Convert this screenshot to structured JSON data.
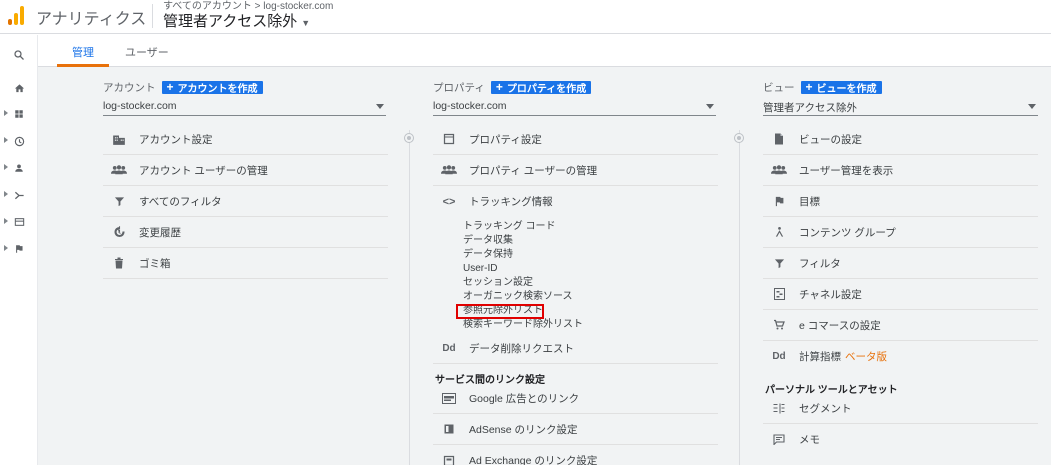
{
  "app": {
    "name": "アナリティクス",
    "breadcrumb": "すべてのアカウント > log-stocker.com",
    "view_title": "管理者アクセス除外"
  },
  "colors": {
    "accent": "#1a73e8",
    "tab_underline": "#e8710a",
    "logo_orange": "#f9ab00",
    "logo_dark": "#e37400",
    "highlight": "#e00000"
  },
  "rail": [
    "search-icon",
    "home-icon",
    "dashboard-icon",
    "clock-icon",
    "person-icon",
    "acquisition-icon",
    "behavior-icon",
    "flag-icon"
  ],
  "tabs": [
    {
      "label": "管理",
      "active": true
    },
    {
      "label": "ユーザー",
      "active": false
    }
  ],
  "account": {
    "heading": "アカウント",
    "create": "アカウントを作成",
    "selected": "log-stocker.com",
    "items": [
      {
        "icon": "building-icon",
        "label": "アカウント設定"
      },
      {
        "icon": "people-icon",
        "label": "アカウント ユーザーの管理"
      },
      {
        "icon": "filter-icon",
        "label": "すべてのフィルタ"
      },
      {
        "icon": "history-icon",
        "label": "変更履歴"
      },
      {
        "icon": "trash-icon",
        "label": "ゴミ箱"
      }
    ]
  },
  "property": {
    "heading": "プロパティ",
    "create": "プロパティを作成",
    "selected": "log-stocker.com",
    "items": [
      {
        "icon": "window-icon",
        "label": "プロパティ設定"
      },
      {
        "icon": "people-icon",
        "label": "プロパティ ユーザーの管理"
      },
      {
        "icon": "code-icon",
        "label": "トラッキング情報"
      }
    ],
    "tracking_sub": [
      "トラッキング コード",
      "データ収集",
      "データ保持",
      "User-ID",
      "セッション設定",
      "オーガニック検索ソース",
      "参照元除外リスト",
      "検索キーワード除外リスト"
    ],
    "delete_request": {
      "icon": "dd-icon",
      "label": "データ削除リクエスト"
    },
    "section": "サービス間のリンク設定",
    "links": [
      {
        "icon": "google-ads-icon",
        "label": "Google 広告とのリンク"
      },
      {
        "icon": "adsense-icon",
        "label": "AdSense のリンク設定"
      },
      {
        "icon": "adexchange-icon",
        "label": "Ad Exchange のリンク設定"
      }
    ]
  },
  "view": {
    "heading": "ビュー",
    "create": "ビューを作成",
    "selected": "管理者アクセス除外",
    "items": [
      {
        "icon": "document-icon",
        "label": "ビューの設定"
      },
      {
        "icon": "people-icon",
        "label": "ユーザー管理を表示"
      },
      {
        "icon": "flag-icon",
        "label": "目標"
      },
      {
        "icon": "grouping-icon",
        "label": "コンテンツ グループ"
      },
      {
        "icon": "filter-icon",
        "label": "フィルタ"
      },
      {
        "icon": "channel-icon",
        "label": "チャネル設定"
      },
      {
        "icon": "cart-icon",
        "label": "e コマースの設定"
      },
      {
        "icon": "dd-icon",
        "label": "計算指標",
        "badge": "ベータ版"
      }
    ],
    "section": "パーソナル ツールとアセット",
    "tools": [
      {
        "icon": "segment-icon",
        "label": "セグメント"
      },
      {
        "icon": "memo-icon",
        "label": "メモ"
      }
    ]
  }
}
